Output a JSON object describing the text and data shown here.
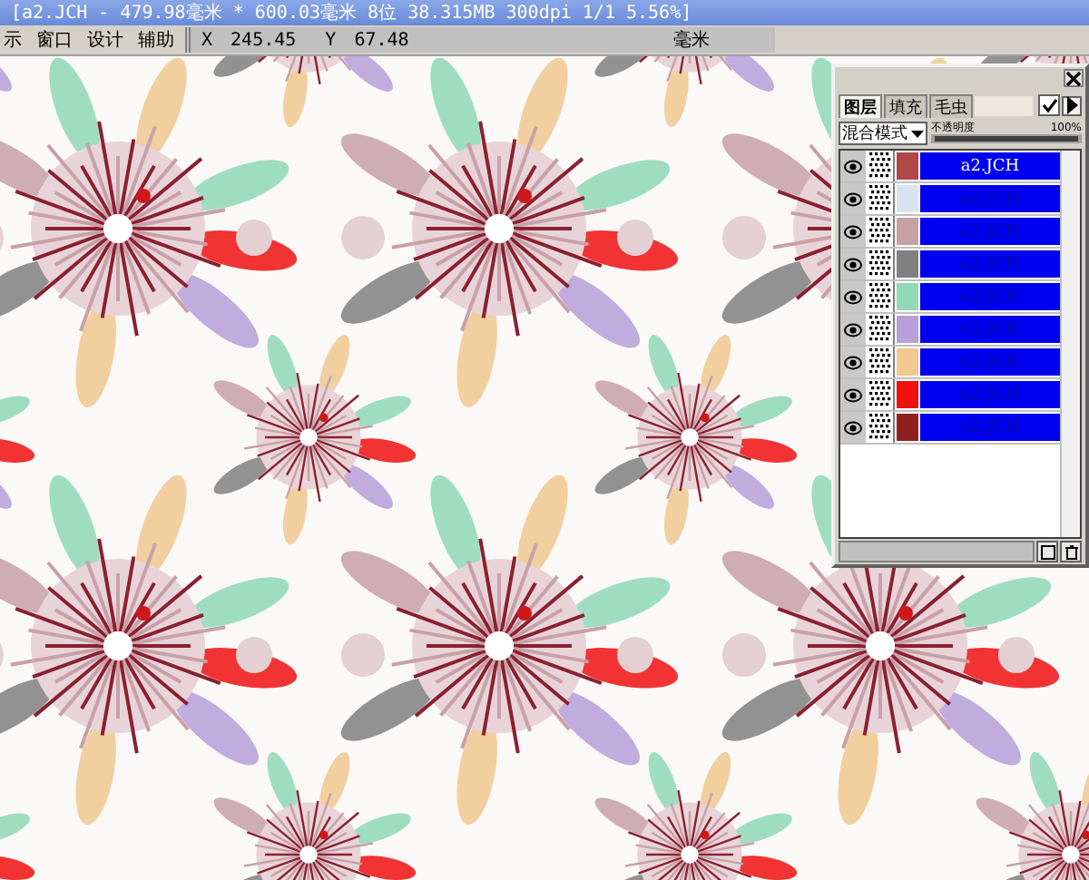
{
  "title_bar": {
    "title": "[a2.JCH - 479.98毫米 * 600.03毫米 8位 38.315MB 300dpi 1/1 5.56%]"
  },
  "menu": [
    {
      "label": "示"
    },
    {
      "label": "窗口"
    },
    {
      "label": "设计"
    },
    {
      "label": "辅助"
    }
  ],
  "coordinates": {
    "x_label": "X",
    "x_value": "245.45",
    "y_label": "Y",
    "y_value": "67.48",
    "unit": "毫米"
  },
  "layers_panel": {
    "tabs": [
      {
        "label": "图层",
        "selected": true
      },
      {
        "label": "填充",
        "selected": false
      },
      {
        "label": "毛虫",
        "selected": false
      }
    ],
    "checked": true,
    "blend_mode": "混合模式",
    "opacity_label": "不透明度",
    "opacity_value": "100%",
    "opacity": {
      "level": 1
    },
    "layers": [
      {
        "name": "a2.JCH",
        "color": "#b04848",
        "selected": true,
        "visible": true
      },
      {
        "name": "a2.JCH",
        "color": "#d8e4f0",
        "selected": false,
        "visible": true
      },
      {
        "name": "a2.JCH",
        "color": "#c8a0a8",
        "selected": false,
        "visible": true
      },
      {
        "name": "a2.JCH",
        "color": "#808080",
        "selected": false,
        "visible": true
      },
      {
        "name": "a2.JCH",
        "color": "#90d8b8",
        "selected": false,
        "visible": true
      },
      {
        "name": "a2.JCH",
        "color": "#b8a0d8",
        "selected": false,
        "visible": true
      },
      {
        "name": "a2.JCH",
        "color": "#f0c890",
        "selected": false,
        "visible": true
      },
      {
        "name": "a2.JCH",
        "color": "#f01010",
        "selected": false,
        "visible": true
      },
      {
        "name": "a2.JCH",
        "color": "#902020",
        "selected": false,
        "visible": true
      }
    ]
  }
}
